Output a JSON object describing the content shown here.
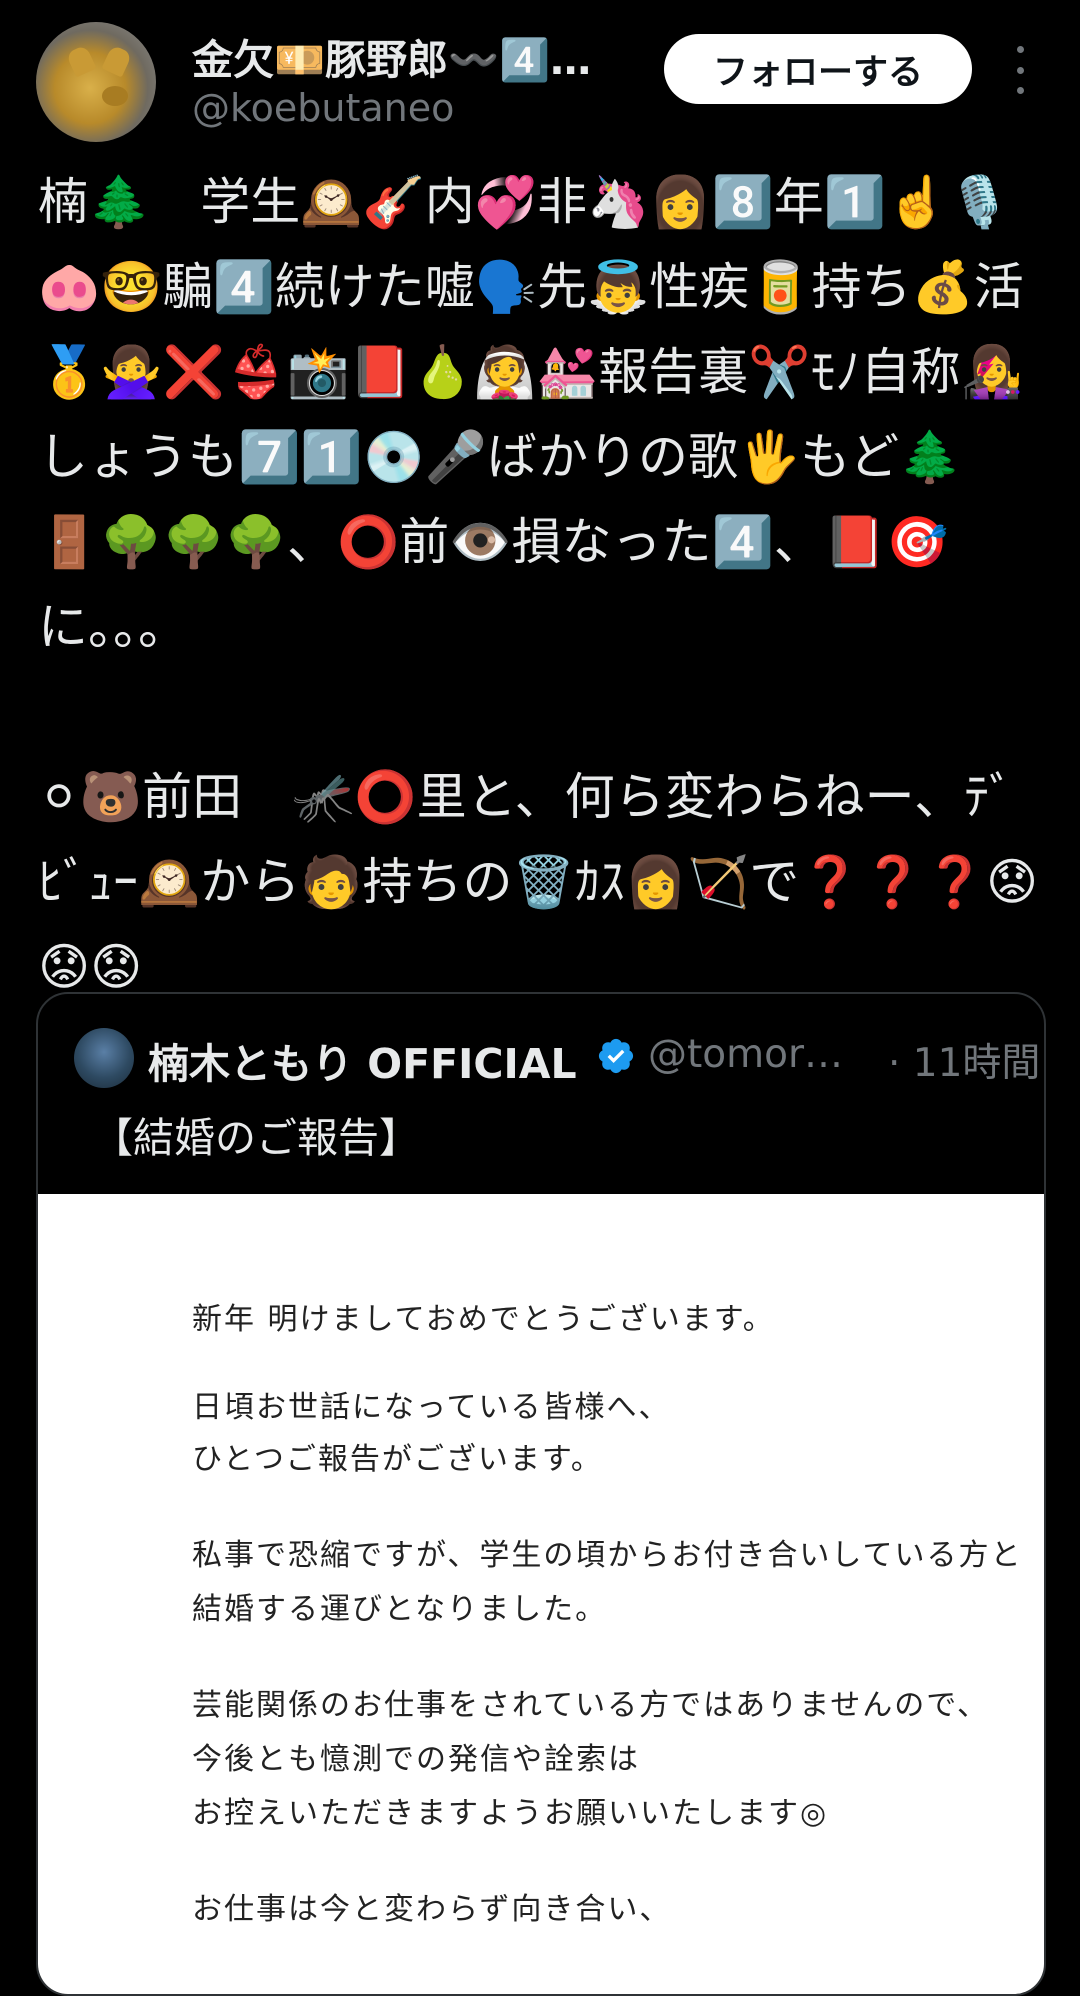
{
  "author": {
    "display_name": "金欠💴豚野郎〰️4️⃣…",
    "handle": "@koebutaneo",
    "follow_label": "フォローする"
  },
  "tweet": {
    "text": "楠🌲　学生🕰️🎸内💞非🦄👩8️⃣年1️⃣☝️🎙️🐽🤓騙4️⃣続けた嘘🗣️先👼性疾🥫持ち💰活🥇🙅‍♀️❌👙📸📕🍐👰💒報告裏✂️ﾓﾉ自称👩‍🎤しょうも7️⃣1️⃣💿🎤ばかりの歌🖐️もど🌲　🚪🌳🌳🌳、⭕前👁️損なった4️⃣、📕🎯に。。。\n\n⚪🐻前田　🦟⭕里と、何ら変わらねー、ﾃﾞﾋﾞｭｰ🕰️から🧑持ちの🗑️ｶｽ👩🏹で❓❓❓😟😟😟"
  },
  "quote": {
    "name": "楠木ともり OFFICIAL",
    "handle": "@tomor…",
    "time": "· 11時間",
    "text": "【結婚のご報告】",
    "verified_color": "#1d9bf0",
    "image_lines": [
      "新年 明けましておめでとうございます。",
      "日頃お世話になっている皆様へ、",
      "ひとつご報告がございます。",
      "私事で恐縮ですが、学生の頃からお付き合いしている方と",
      "結婚する運びとなりました。",
      "芸能関係のお仕事をされている方ではありませんので、",
      "今後とも憶測での発信や詮索は",
      "お控えいただきますようお願いいたします◎",
      "お仕事は今と変わらず向き合い、"
    ]
  }
}
